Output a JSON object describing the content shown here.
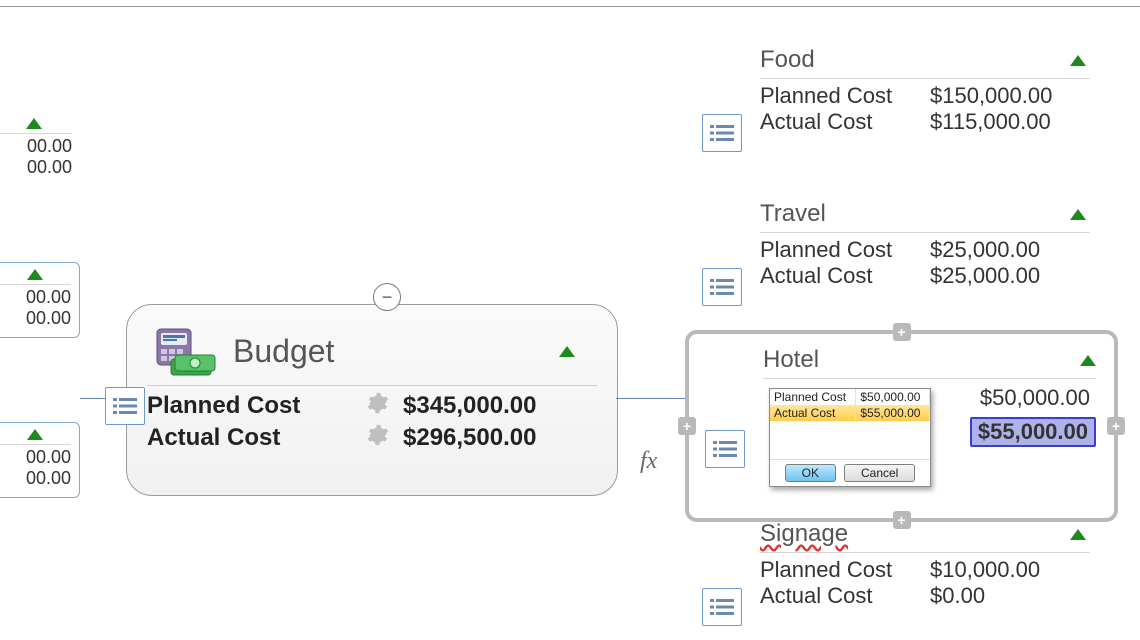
{
  "budget": {
    "title": "Budget",
    "planned_label": "Planned Cost",
    "actual_label": "Actual Cost",
    "planned_value": "$345,000.00",
    "actual_value": "$296,500.00",
    "collapse_glyph": "−"
  },
  "fx_label": "fx",
  "left_stubs": {
    "a": {
      "v1": "00.00",
      "v2": "00.00"
    },
    "b": {
      "v1": "00.00",
      "v2": "00.00"
    },
    "c": {
      "v1": "00.00",
      "v2": "00.00"
    }
  },
  "right": {
    "food": {
      "title": "Food",
      "planned_label": "Planned Cost",
      "actual_label": "Actual Cost",
      "planned": "$150,000.00",
      "actual": "$115,000.00"
    },
    "travel": {
      "title": "Travel",
      "planned_label": "Planned Cost",
      "actual_label": "Actual Cost",
      "planned": "$25,000.00",
      "actual": "$25,000.00"
    },
    "hotel": {
      "title": "Hotel",
      "planned_label": "Planned Cost",
      "actual_label": "Actual Cost",
      "planned": "$50,000.00",
      "actual": "$55,000.00"
    },
    "signage": {
      "title": "Signage",
      "planned_label": "Planned Cost",
      "actual_label": "Actual Cost",
      "planned": "$10,000.00",
      "actual": "$0.00"
    }
  },
  "popup": {
    "planned_label": "Planned Cost",
    "actual_label": "Actual Cost",
    "planned": "$50,000.00",
    "actual": "$55,000.00",
    "ok": "OK",
    "cancel": "Cancel"
  },
  "plus_glyph": "+"
}
